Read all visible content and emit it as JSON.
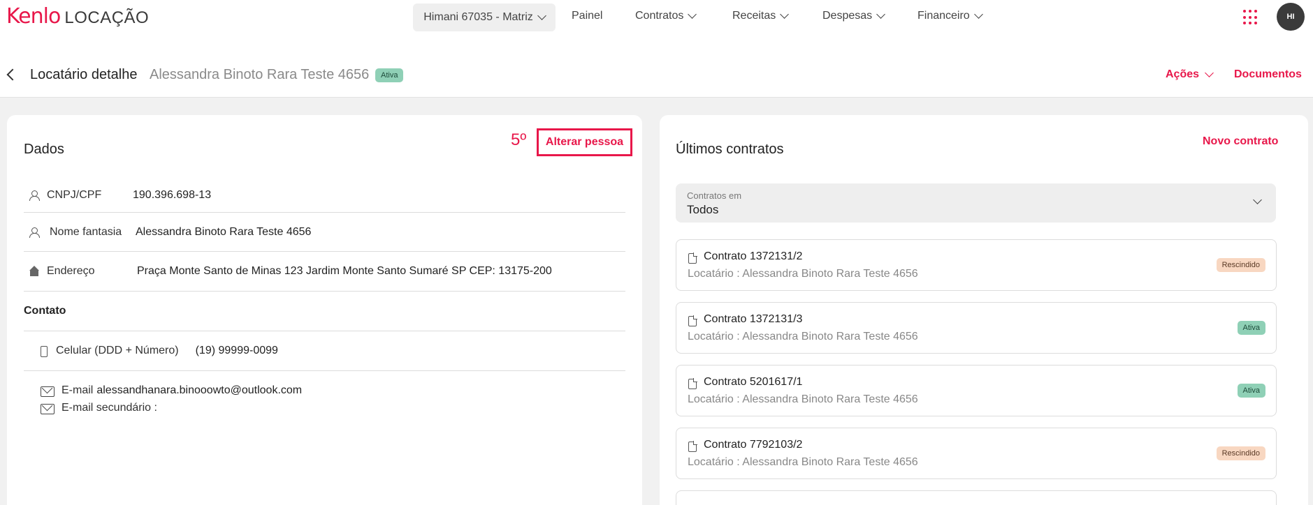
{
  "app": {
    "brand": "Kenlo",
    "product": "LOCAÇÃO"
  },
  "topnav": {
    "branch": "Himani 67035 - Matriz",
    "items": [
      "Painel",
      "Contratos",
      "Receitas",
      "Despesas",
      "Financeiro"
    ],
    "avatar_initials": "HI"
  },
  "header": {
    "title": "Locatário detalhe",
    "tenant_name": "Alessandra Binoto Rara Teste 4656",
    "status": "Ativa",
    "actions_label": "Ações",
    "documents_label": "Documentos"
  },
  "dados": {
    "title": "Dados",
    "step_marker": "5º",
    "alterar_label": "Alterar pessoa",
    "fields": [
      {
        "icon": "person-icon",
        "label": "CNPJ/CPF",
        "value": "190.396.698-13"
      },
      {
        "icon": "person-icon",
        "label": "Nome fantasia",
        "value": "Alessandra Binoto Rara Teste 4656"
      },
      {
        "icon": "home-icon",
        "label": "Endereço",
        "value": "Praça Monte Santo de Minas 123 Jardim Monte Santo Sumaré SP CEP: 13175-200"
      }
    ],
    "contato_title": "Contato",
    "phone": {
      "label": "Celular (DDD + Número)",
      "value": "(19) 99999-0099"
    },
    "email": {
      "label": "E-mail",
      "value": "alessandhanara.binooowto@outlook.com"
    },
    "email_secondary": {
      "label": "E-mail secundário :",
      "value": ""
    }
  },
  "contracts": {
    "title": "Últimos contratos",
    "new_label": "Novo contrato",
    "filter_label": "Contratos em",
    "filter_value": "Todos",
    "items": [
      {
        "title": "Contrato 1372131/2",
        "subtitle": "Locatário : Alessandra Binoto Rara Teste 4656",
        "status": "Rescindido"
      },
      {
        "title": "Contrato 1372131/3",
        "subtitle": "Locatário : Alessandra Binoto Rara Teste 4656",
        "status": "Ativa"
      },
      {
        "title": "Contrato 5201617/1",
        "subtitle": "Locatário : Alessandra Binoto Rara Teste 4656",
        "status": "Ativa"
      },
      {
        "title": "Contrato 7792103/2",
        "subtitle": "Locatário : Alessandra Binoto Rara Teste 4656",
        "status": "Rescindido"
      }
    ]
  },
  "colors": {
    "accent": "#e8174a",
    "active_badge": "#8fd0b6",
    "terminated_badge": "#f8d7c1"
  }
}
